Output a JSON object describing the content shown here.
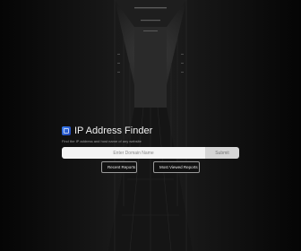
{
  "app": {
    "title": "IP Address Finder",
    "subtitle": "Find the IP address and host name of any website",
    "logo_icon": "globe-icon",
    "accent_color": "#3b82f6"
  },
  "search": {
    "placeholder": "Enter Domain Name",
    "value": "",
    "submit_label": "Submit"
  },
  "actions": {
    "recent_label": "Recent Reports",
    "most_viewed_label": "Most Viewed Reports"
  }
}
